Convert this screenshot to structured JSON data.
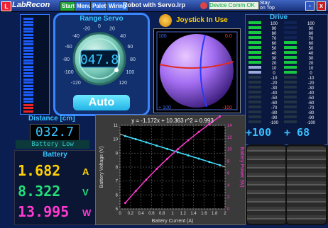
{
  "titlebar": {
    "app_name": "LabRecon",
    "logo_letter": "L",
    "buttons": {
      "start": "Start",
      "menu": "Menu",
      "palette": "Palette",
      "wiring": "Wiring"
    },
    "filename": "Robot with Servo.lrp",
    "comm_status": "Device Comm OK",
    "stay_on_top_line1": "Stay",
    "stay_on_top_line2": "on Top",
    "minimize": "-",
    "close": "x"
  },
  "servo": {
    "title": "Range  Servo",
    "value": "047.8",
    "dial_ticks": [
      "-120",
      "-100",
      "-80",
      "-60",
      "-40",
      "-20",
      "0",
      "20",
      "40",
      "60",
      "80",
      "100",
      "120"
    ],
    "mode_button": "Auto"
  },
  "joystick": {
    "label": "Joystick In Use",
    "corner_tl": "100",
    "corner_tr": "0.0",
    "corner_bl": "+ 100",
    "corner_br": "-100"
  },
  "drive": {
    "title": "Drive",
    "scale": [
      "100",
      "90",
      "80",
      "70",
      "60",
      "50",
      "40",
      "30",
      "20",
      "10",
      "0",
      "-10",
      "-20",
      "-30",
      "-40",
      "-50",
      "-60",
      "-70",
      "-80",
      "-90",
      "-100"
    ],
    "left_value": "+100",
    "right_value": "+ 68"
  },
  "distance": {
    "label": "Distance [cm]",
    "value": "032.7"
  },
  "battery_low": "Battery Low",
  "battery": {
    "title": "Battery",
    "current": "1.682",
    "current_unit": "A",
    "voltage": "8.322",
    "voltage_unit": "V",
    "power": "13.995",
    "power_unit": "W"
  },
  "colors": {
    "accent_cyan": "#39c6ff",
    "current_color": "#ffd000",
    "voltage_color": "#22e07a",
    "power_color": "#ff3ad0"
  },
  "chart_data": {
    "type": "scatter",
    "title": "y = -1.172x + 10.363     r^2 = 0.993",
    "xlabel": "Battery Current (A)",
    "ylabel": "Battery Voltage (V)",
    "y2label": "Battery Power (W)",
    "xlim": [
      0,
      2
    ],
    "ylim": [
      5,
      11
    ],
    "y2lim": [
      0,
      14
    ],
    "x_ticks": [
      "0",
      "0.2",
      "0.4",
      "0.6",
      "0.8",
      "1",
      "1.2",
      "1.4",
      "1.6",
      "1.8",
      "2"
    ],
    "y_ticks": [
      "5",
      "6",
      "7",
      "8",
      "9",
      "10",
      "11"
    ],
    "y2_ticks": [
      "0",
      "2",
      "4",
      "6",
      "8",
      "10",
      "12",
      "14"
    ],
    "series": [
      {
        "color": "#3ee0ff",
        "axis": "y",
        "x": [
          0.1,
          0.3,
          0.5,
          0.7,
          0.9,
          1.1,
          1.3,
          1.5,
          1.7,
          1.9
        ],
        "y": [
          10.23,
          10.01,
          9.78,
          9.54,
          9.31,
          9.07,
          8.84,
          8.61,
          8.37,
          8.14
        ]
      },
      {
        "color": "#ff3ad0",
        "axis": "y2",
        "x": [
          0.1,
          0.3,
          0.5,
          0.7,
          0.9,
          1.1,
          1.3,
          1.5,
          1.7,
          1.9
        ],
        "y": [
          1.0,
          3.0,
          4.9,
          6.7,
          8.4,
          10.0,
          11.5,
          12.9,
          14.2,
          15.5
        ]
      }
    ],
    "trend_line": {
      "slope": -1.172,
      "intercept": 10.363
    },
    "grid": true
  }
}
